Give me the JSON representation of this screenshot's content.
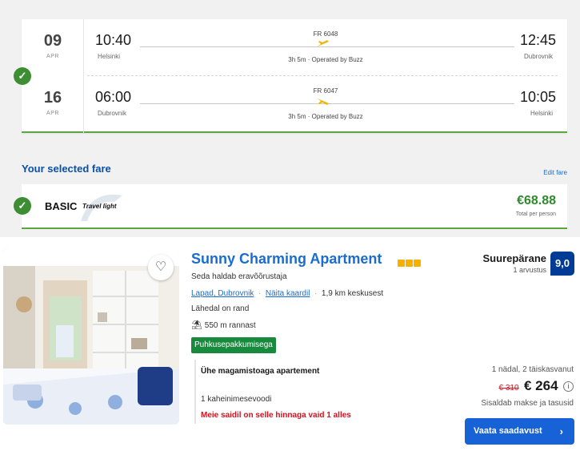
{
  "flights": [
    {
      "day": "09",
      "month": "APR",
      "dep_time": "10:40",
      "dep_city": "Helsinki",
      "flight_no": "FR 6048",
      "duration": "3h 5m · Operated by Buzz",
      "arr_time": "12:45",
      "arr_city": "Dubrovnik"
    },
    {
      "day": "16",
      "month": "APR",
      "dep_time": "06:00",
      "dep_city": "Dubrovnik",
      "flight_no": "FR 6047",
      "duration": "3h 5m · Operated by Buzz",
      "arr_time": "10:05",
      "arr_city": "Helsinki"
    }
  ],
  "fare": {
    "heading": "Your selected fare",
    "edit_label": "Edit fare",
    "name": "BASIC",
    "tagline": "Travel light",
    "price": "€68.88",
    "price_sub": "Total per person"
  },
  "hotel": {
    "title": "Sunny Charming Apartment",
    "star_count": 3,
    "managed_by": "Seda haldab eravõõrustaja",
    "location_link": "Lapad, Dubrovnik",
    "map_link": "Näita kaardil",
    "distance": "1,9 km keskusest",
    "near_beach": "Lähedal on rand",
    "beach_distance": "550 m rannast",
    "deal_badge": "Puhkusepakkumisega",
    "room_name": "Ühe magamistoaga apartement",
    "bed": "1 kaheinimesevoodi",
    "scarcity": "Meie saidil on selle hinnaga vaid 1 alles",
    "rating_word": "Suurepärane",
    "rating_count": "1 arvustus",
    "score": "9,0",
    "stay_info": "1 nädal, 2 täiskasvanut",
    "old_price": "€ 310",
    "new_price": "€ 264",
    "tax_note": "Sisaldab makse ja tasusid",
    "cta_label": "Vaata saadavust"
  },
  "colors": {
    "brand_blue": "#003b95",
    "link_blue": "#1a6cd1",
    "fare_green": "#2e8a2c",
    "check_green": "#3d8e33",
    "alert_red": "#d4111e",
    "plane_yellow": "#f2b600"
  }
}
